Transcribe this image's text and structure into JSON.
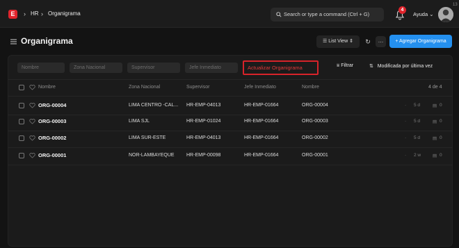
{
  "topbar": {
    "logo_letter": "E",
    "breadcrumbs": [
      "HR",
      "Organigrama"
    ],
    "search_placeholder": "Search or type a command (Ctrl + G)",
    "notification_count": "4",
    "help_label": "Ayuda",
    "corner_number": "13"
  },
  "page": {
    "title": "Organigrama",
    "list_view_label": "List View",
    "add_button_label": "+ Agregar Organigrama"
  },
  "filters": {
    "nombre_placeholder": "Nombre",
    "zona_placeholder": "Zona Nacional",
    "supervisor_placeholder": "Supervisor",
    "jefe_placeholder": "Jefe Inmediato",
    "update_button_label": "Actualizar Organigrama",
    "filter_label": "Filtrar",
    "sort_label": "Modificada por última vez"
  },
  "table": {
    "columns": [
      "Nombre",
      "Zona Nacional",
      "Supervisor",
      "Jefe Inmediato",
      "Nombre"
    ],
    "count_label": "4 de 4",
    "rows": [
      {
        "id": "ORG-00004",
        "zona": "LIMA CENTRO -CAL...",
        "supervisor": "HR-EMP-04013",
        "jefe": "HR-EMP-01664",
        "nombre": "ORG-00004",
        "age": "5 d",
        "comments": "0"
      },
      {
        "id": "ORG-00003",
        "zona": "LIMA SJL",
        "supervisor": "HR-EMP-01024",
        "jefe": "HR-EMP-01664",
        "nombre": "ORG-00003",
        "age": "5 d",
        "comments": "0"
      },
      {
        "id": "ORG-00002",
        "zona": "LIMA SUR-ESTE",
        "supervisor": "HR-EMP-04013",
        "jefe": "HR-EMP-01664",
        "nombre": "ORG-00002",
        "age": "5 d",
        "comments": "0"
      },
      {
        "id": "ORG-00001",
        "zona": "NOR-LAMBAYEQUE",
        "supervisor": "HR-EMP-00098",
        "jefe": "HR-EMP-01664",
        "nombre": "ORG-00001",
        "age": "2 w",
        "comments": "0"
      }
    ]
  },
  "colors": {
    "accent": "#2490ef",
    "danger": "#e0242c",
    "background": "#131313",
    "panel": "#1b1b1b"
  },
  "icons": [
    "app-logo-icon",
    "chevron-right-icon",
    "search-icon",
    "bell-icon",
    "chevron-down-icon",
    "hamburger-icon",
    "list-icon",
    "refresh-icon",
    "ellipsis-icon",
    "filter-icon",
    "sort-icon",
    "checkbox-icon",
    "heart-icon",
    "comment-icon"
  ]
}
